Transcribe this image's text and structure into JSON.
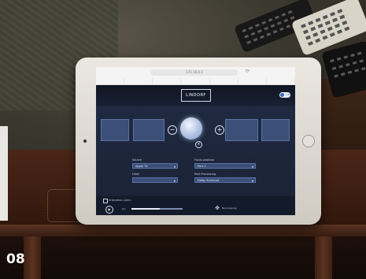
{
  "photo_label": "08",
  "browser": {
    "url": "172.16.0.1",
    "tabs": [
      "",
      "",
      "",
      "",
      "",
      "",
      ""
    ]
  },
  "app": {
    "header_left_line1": "",
    "header_left_line2": "",
    "logo": "LINDORF",
    "toggle_text": "ON"
  },
  "chain": {
    "source_selector": "",
    "source_format": "",
    "output_format": "",
    "soundfield": ""
  },
  "volume_value": "",
  "controls": {
    "source_label": "Source",
    "source_value": "Apple TV",
    "focus_label": "Focus position",
    "focus_value": "Pers 1",
    "hdmi_label": "Hdmi",
    "hdmi_value": "",
    "proc_label": "Post Processing",
    "proc_value": "Dolby Surround"
  },
  "bottom": {
    "checkbox_label": "STREAMING AUDIO",
    "mid_label": "",
    "volume_label": "Vol",
    "volume_level": 0.55,
    "now_playing_label": "Now playing"
  }
}
